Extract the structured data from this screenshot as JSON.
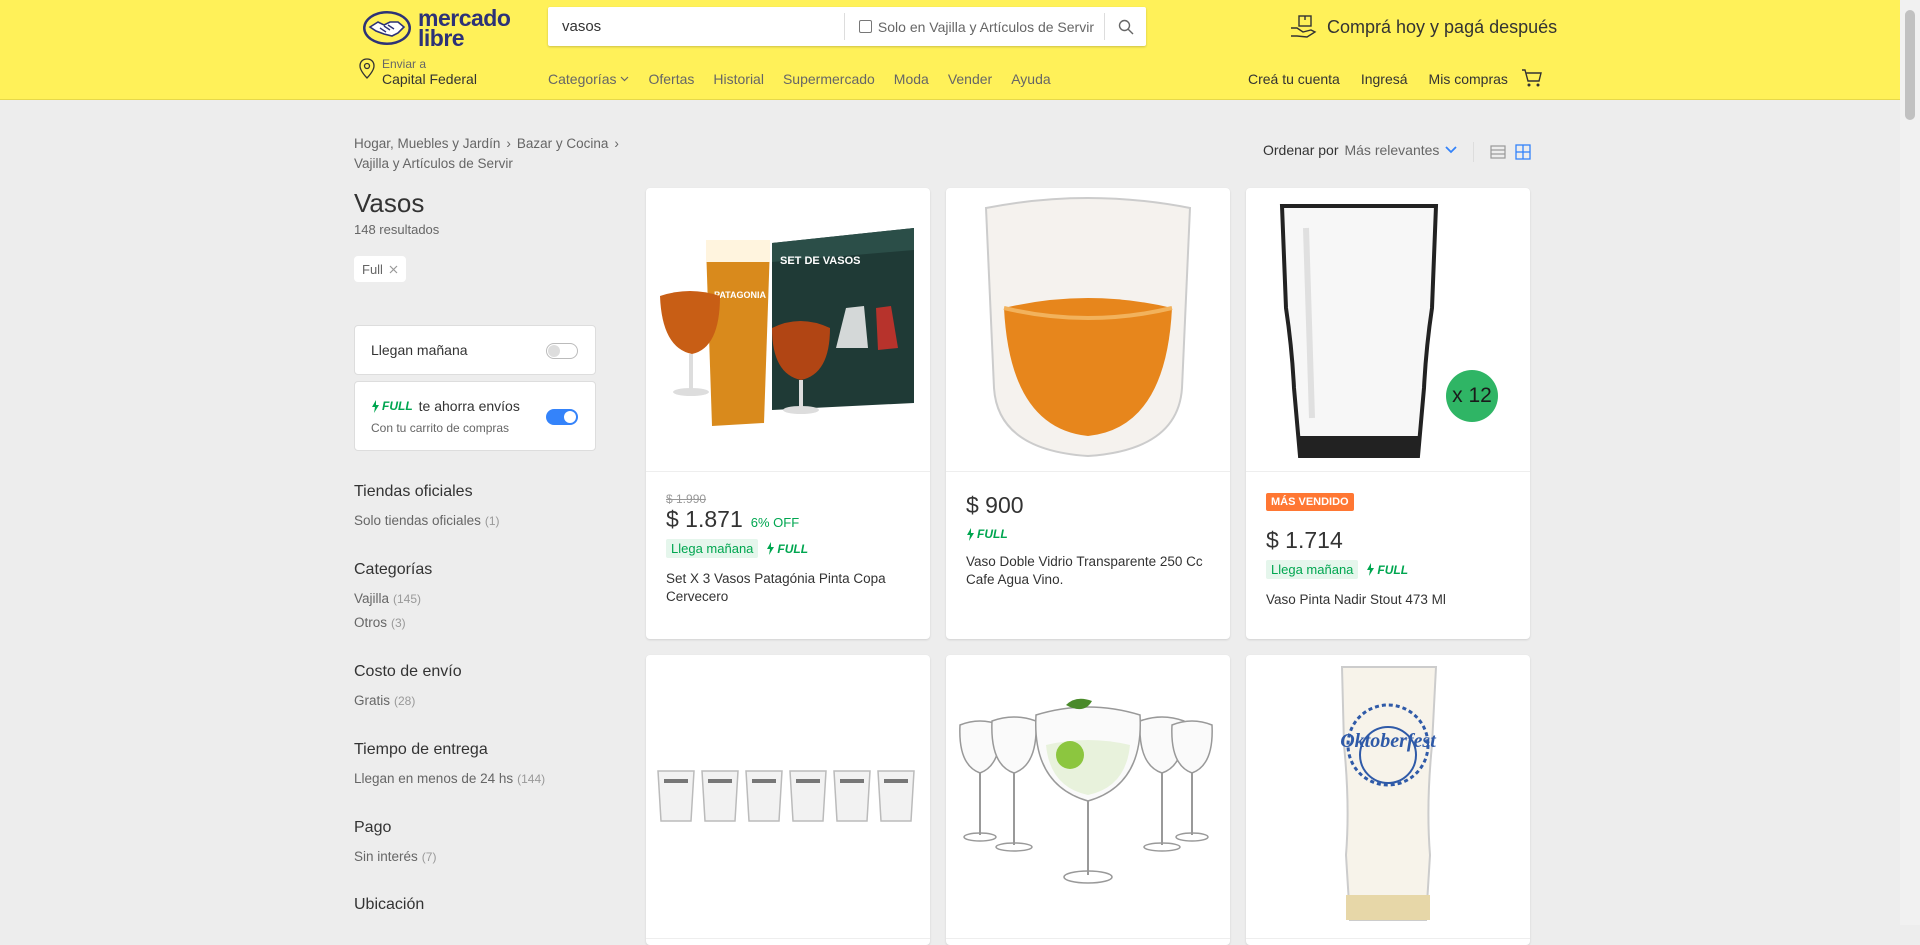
{
  "header": {
    "logo": {
      "line1": "mercado",
      "line2": "libre"
    },
    "search": {
      "value": "vasos",
      "filter_label": "Solo en Vajilla y Artículos de Servir"
    },
    "promo": "Comprá hoy y pagá después",
    "location": {
      "label": "Enviar a",
      "value": "Capital Federal"
    },
    "nav": [
      "Categorías",
      "Ofertas",
      "Historial",
      "Supermercado",
      "Moda",
      "Vender",
      "Ayuda"
    ],
    "user_nav": [
      "Creá tu cuenta",
      "Ingresá",
      "Mis compras"
    ]
  },
  "breadcrumb": [
    "Hogar, Muebles y Jardín",
    "Bazar y Cocina",
    "Vajilla y Artículos de Servir"
  ],
  "page": {
    "title": "Vasos",
    "results": "148 resultados",
    "active_filter": "Full"
  },
  "toggles": {
    "llegan": {
      "label": "Llegan mañana",
      "on": false
    },
    "full": {
      "brand": "FULL",
      "text": "te ahorra envíos",
      "sub": "Con tu carrito de compras",
      "on": true
    }
  },
  "filters": [
    {
      "title": "Tiendas oficiales",
      "items": [
        {
          "label": "Solo tiendas oficiales",
          "count": "(1)"
        }
      ]
    },
    {
      "title": "Categorías",
      "items": [
        {
          "label": "Vajilla",
          "count": "(145)"
        },
        {
          "label": "Otros",
          "count": "(3)"
        }
      ]
    },
    {
      "title": "Costo de envío",
      "items": [
        {
          "label": "Gratis",
          "count": "(28)"
        }
      ]
    },
    {
      "title": "Tiempo de entrega",
      "items": [
        {
          "label": "Llegan en menos de 24 hs",
          "count": "(144)"
        }
      ]
    },
    {
      "title": "Pago",
      "items": [
        {
          "label": "Sin interés",
          "count": "(7)"
        }
      ]
    },
    {
      "title": "Ubicación",
      "items": []
    }
  ],
  "sort": {
    "label": "Ordenar por",
    "value": "Más relevantes"
  },
  "products": [
    {
      "old_price": "$ 1.990",
      "price": "$ 1.871",
      "discount": "6% OFF",
      "arrival": "Llega mañana",
      "full": "FULL",
      "title": "Set X 3 Vasos Patagónia Pinta Copa Cervecero",
      "image_text": [
        "SET DE VASOS",
        "PATAGONIA"
      ]
    },
    {
      "price": "$ 900",
      "full": "FULL",
      "title": "Vaso Doble Vidrio Transparente 250 Cc Cafe Agua Vino."
    },
    {
      "badge": "MÁS VENDIDO",
      "price": "$ 1.714",
      "arrival": "Llega mañana",
      "full": "FULL",
      "title": "Vaso Pinta Nadir Stout 473 Ml",
      "image_badge": "x 12"
    },
    {
      "title": ""
    },
    {
      "title": ""
    },
    {
      "title": "",
      "image_text": "Oktoberfest"
    }
  ],
  "colors": {
    "header_bg": "#fff159",
    "accent": "#3483fa",
    "green": "#00a650",
    "badge": "#ff7733"
  }
}
